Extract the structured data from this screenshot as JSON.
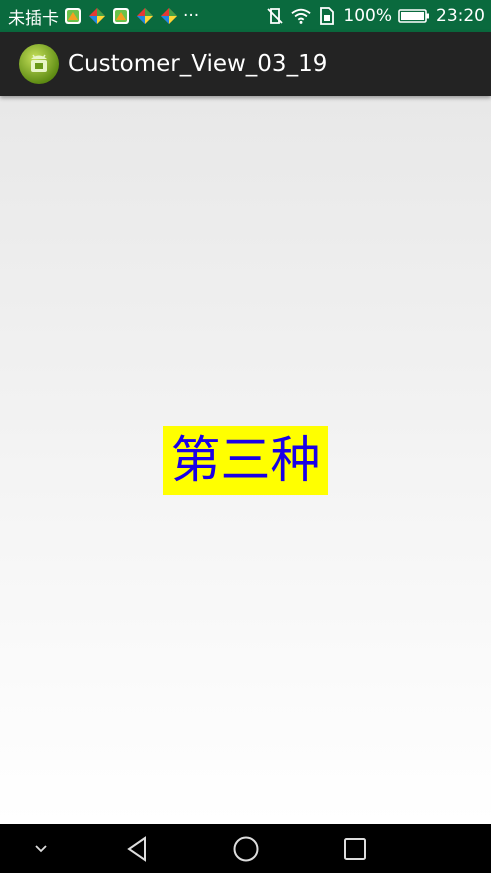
{
  "status_bar": {
    "carrier": "未插卡",
    "overflow": "···",
    "battery_percent": "100%",
    "time": "23:20",
    "notification_icons": [
      "app-notification-icon",
      "colorful-app-icon",
      "app-notification-icon",
      "colorful-app-icon",
      "colorful-app-icon"
    ],
    "system_icons": [
      "vibrate-off-icon",
      "wifi-icon",
      "sim-data-icon",
      "battery-icon"
    ]
  },
  "action_bar": {
    "title": "Customer_View_03_19",
    "icon": "android-app-icon"
  },
  "content": {
    "custom_view_text": "第三种",
    "custom_view_bg": "#ffff00",
    "custom_view_color": "#1a00e6"
  },
  "nav_bar": {
    "buttons": [
      "hide-nav-icon",
      "back-icon",
      "home-icon",
      "recents-icon"
    ]
  },
  "colors": {
    "status_bar_bg": "#0a6a3e",
    "action_bar_bg": "#232323"
  }
}
